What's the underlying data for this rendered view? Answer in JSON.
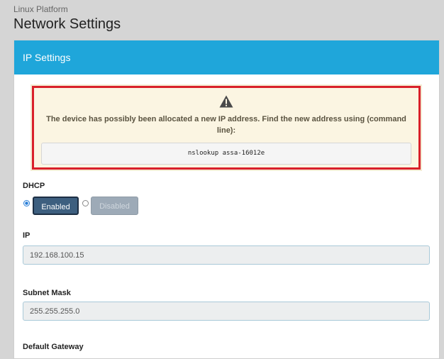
{
  "header": {
    "breadcrumb": "Linux Platform",
    "title": "Network Settings"
  },
  "panel": {
    "heading": "IP Settings"
  },
  "alert": {
    "icon": "warning-icon",
    "message": "The device has possibly been allocated a new IP address. Find the new address using (command line):",
    "command": "nslookup assa-16012e",
    "border_color": "#d9202a"
  },
  "dhcp": {
    "label": "DHCP",
    "enabled_label": "Enabled",
    "disabled_label": "Disabled",
    "selected": "Enabled"
  },
  "ip": {
    "label": "IP",
    "value": "192.168.100.15"
  },
  "subnet": {
    "label": "Subnet Mask",
    "value": "255.255.255.0"
  },
  "gateway": {
    "label": "Default Gateway"
  },
  "colors": {
    "panel_heading": "#1fa6da",
    "enabled_button": "#3d5f7f",
    "disabled_button": "#9daab7"
  }
}
